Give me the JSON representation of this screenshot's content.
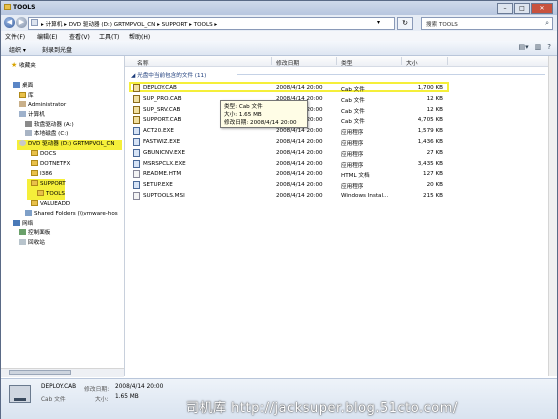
{
  "window": {
    "title": "TOOLS"
  },
  "address": {
    "crumbs": "▸ 计算机 ▸ DVD 驱动器 (D:) GRTMPVOL_CN ▸ SUPPORT ▸ TOOLS ▸",
    "search_placeholder": "搜索 TOOLS"
  },
  "menu": {
    "file": "文件(F)",
    "edit": "编辑(E)",
    "view": "查看(V)",
    "tools": "工具(T)",
    "help": "帮助(H)"
  },
  "cmd": {
    "organize": "组织 ▾",
    "burn": "刻录到光盘"
  },
  "tree": {
    "favorites": "收藏夹",
    "desktop": "桌面",
    "library": "库",
    "admin": "Administrator",
    "computer": "计算机",
    "floppy": "软盘驱动器 (A:)",
    "localdisk": "本地磁盘 (C:)",
    "dvd": "DVD 驱动器 (D:) GRTMPVOL_CN",
    "docs": "DOCS",
    "dotnet": "DOTNETFX",
    "i386": "I386",
    "support": "SUPPORT",
    "tools": "TOOLS",
    "valueadd": "VALUEADD",
    "shared": "Shared Folders (\\\\vmware-hos",
    "network": "网络",
    "control": "控制面板",
    "recycle": "回收站"
  },
  "columns": {
    "name": "名称",
    "date": "修改日期",
    "type": "类型",
    "size": "大小"
  },
  "group_label": "光盘中当前包含的文件 (11)",
  "files": [
    {
      "name": "DEPLOY.CAB",
      "date": "2008/4/14 20:00",
      "type": "Cab 文件",
      "size": "1,700 KB",
      "icon": "cab"
    },
    {
      "name": "SUP_PRO.CAB",
      "date": "2008/4/14 20:00",
      "type": "Cab 文件",
      "size": "12 KB",
      "icon": "cab"
    },
    {
      "name": "SUP_SRV.CAB",
      "date": "2008/4/14 20:00",
      "type": "Cab 文件",
      "size": "12 KB",
      "icon": "cab"
    },
    {
      "name": "SUPPORT.CAB",
      "date": "2008/4/14 20:00",
      "type": "Cab 文件",
      "size": "4,705 KB",
      "icon": "cab"
    },
    {
      "name": "ACT20.EXE",
      "date": "2008/4/14 20:00",
      "type": "应用程序",
      "size": "1,579 KB",
      "icon": "exe"
    },
    {
      "name": "FASTWIZ.EXE",
      "date": "2008/4/14 20:00",
      "type": "应用程序",
      "size": "1,436 KB",
      "icon": "exe"
    },
    {
      "name": "GBUNICNV.EXE",
      "date": "2008/4/14 20:00",
      "type": "应用程序",
      "size": "27 KB",
      "icon": "exe"
    },
    {
      "name": "MSRSPCLX.EXE",
      "date": "2008/4/14 20:00",
      "type": "应用程序",
      "size": "3,435 KB",
      "icon": "exe"
    },
    {
      "name": "README.HTM",
      "date": "2008/4/14 20:00",
      "type": "HTML 文档",
      "size": "127 KB",
      "icon": "htm"
    },
    {
      "name": "SETUP.EXE",
      "date": "2008/4/14 20:00",
      "type": "应用程序",
      "size": "20 KB",
      "icon": "exe"
    },
    {
      "name": "SUPTOOLS.MSI",
      "date": "2008/4/14 20:00",
      "type": "Windows Instal...",
      "size": "215 KB",
      "icon": "msi"
    }
  ],
  "tooltip": {
    "type": "类型: Cab 文件",
    "size": "大小: 1.65 MB",
    "date": "修改日期: 2008/4/14 20:00"
  },
  "status": {
    "name": "DEPLOY.CAB",
    "mod_label": "修改日期:",
    "mod_value": "2008/4/14 20:00",
    "type": "Cab 文件",
    "size_label": "大小:",
    "size_value": "1.65 MB"
  },
  "watermark": "司机库 http://jacksuper.blog.51cto.com/"
}
